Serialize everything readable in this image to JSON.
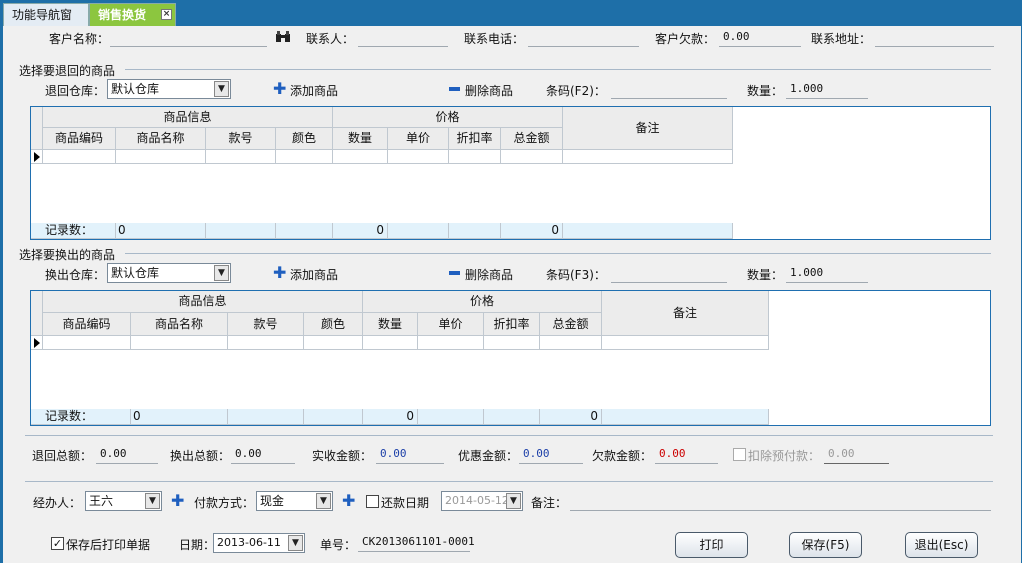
{
  "tabs": {
    "nav": "功能导航窗口",
    "sales": "销售换货",
    "close": "×"
  },
  "customer": {
    "name_label": "客户名称：",
    "name": "",
    "contact_label": "联系人：",
    "contact": "",
    "phone_label": "联系电话：",
    "phone": "",
    "debt_label": "客户欠款：",
    "debt": "0.00",
    "address_label": "联系地址：",
    "address": ""
  },
  "return_section": {
    "title": "选择要退回的商品",
    "warehouse_label": "退回仓库：",
    "warehouse": "默认仓库",
    "add": "添加商品",
    "delete": "删除商品",
    "barcode_label": "条码(F2)：",
    "barcode": "",
    "qty_label": "数量：",
    "qty": "1.000"
  },
  "exchange_section": {
    "title": "选择要换出的商品",
    "warehouse_label": "换出仓库：",
    "warehouse": "默认仓库",
    "add": "添加商品",
    "delete": "删除商品",
    "barcode_label": "条码(F3)：",
    "barcode": "",
    "qty_label": "数量：",
    "qty": "1.000"
  },
  "grid": {
    "group_goods": "商品信息",
    "group_price": "价格",
    "remark": "备注",
    "columns": [
      "商品编码",
      "商品名称",
      "款号",
      "颜色",
      "数量",
      "单价",
      "折扣率",
      "总金额"
    ],
    "footer_label": "记录数：",
    "count": "0",
    "qty_sum": "0",
    "amount_sum": "0"
  },
  "totals": {
    "return_total_label": "退回总额：",
    "return_total": "0.00",
    "exchange_total_label": "换出总额：",
    "exchange_total": "0.00",
    "received_label": "实收金额：",
    "received": "0.00",
    "discount_label": "优惠金额：",
    "discount": "0.00",
    "owed_label": "欠款金额：",
    "owed": "0.00",
    "prepay_label": "扣除预付款：",
    "prepay": "0.00"
  },
  "form": {
    "handler_label": "经办人：",
    "handler": "王六",
    "payment_label": "付款方式：",
    "payment": "现金",
    "repay_label": "还款日期",
    "repay_date": "2014-05-12",
    "note_label": "备注：",
    "note": ""
  },
  "bottom": {
    "print_after_save": "保存后打印单据",
    "date_label": "日期：",
    "date": "2013-06-11",
    "order_label": "单号：",
    "order_no": "CK2013061101-0001",
    "print": "打印",
    "save": "保存(F5)",
    "exit": "退出(Esc)"
  },
  "colors": {
    "owed": "#cc0000",
    "amount": "#1c3fa8",
    "tab_active": "#8cc63f"
  }
}
